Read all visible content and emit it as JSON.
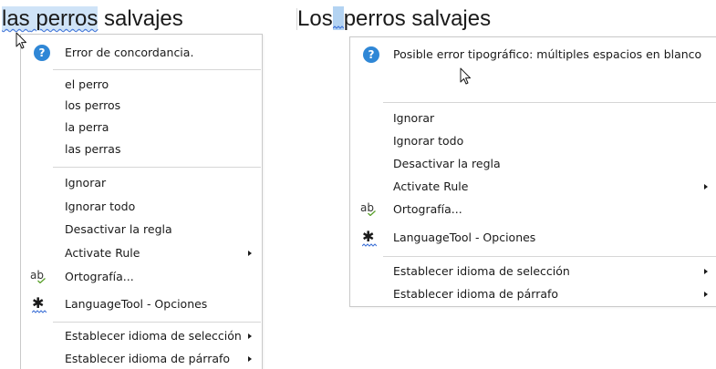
{
  "left_doc": {
    "word1": "las",
    "space1": " ",
    "word2": "perros",
    "rest": " salvajes"
  },
  "right_doc": {
    "word1": "Los",
    "rest": "perros salvajes"
  },
  "left_menu": {
    "header": {
      "icon": "help-icon",
      "label": "Error de concordancia."
    },
    "suggestions": [
      "el perro",
      "los perros",
      "la perra",
      "las perras"
    ],
    "items": {
      "ignore": "Ignorar",
      "ignore_all": "Ignorar todo",
      "disable_rule": "Desactivar la regla",
      "activate_rule": "Activate Rule",
      "spelling": "Ortografía...",
      "options": "LanguageTool - Opciones",
      "set_selection_lang": "Establecer idioma de selección",
      "set_paragraph_lang": "Establecer idioma de párrafo"
    }
  },
  "right_menu": {
    "header": {
      "icon": "help-icon",
      "label": "Posible error tipográfico: múltiples espacios en blanco"
    },
    "items": {
      "ignore": "Ignorar",
      "ignore_all": "Ignorar todo",
      "disable_rule": "Desactivar la regla",
      "activate_rule": "Activate Rule",
      "spelling": "Ortografía...",
      "options": "LanguageTool - Opciones",
      "set_selection_lang": "Establecer idioma de selección",
      "set_paragraph_lang": "Establecer idioma de párrafo"
    }
  },
  "icons": {
    "help": "help-icon",
    "spelling": "spellcheck-icon",
    "options": "gear-icon",
    "submenu": "chevron-right-icon",
    "pointer": "mouse-pointer-icon"
  },
  "colors": {
    "selection": "#cfe3f7",
    "error_underline": "#3b6fd6",
    "help_icon": "#2f87d6"
  }
}
